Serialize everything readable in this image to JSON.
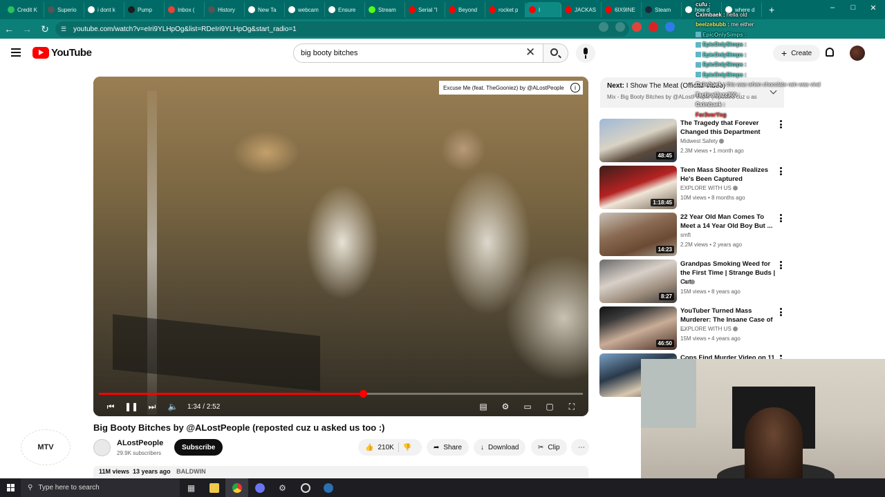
{
  "browser": {
    "tabs": [
      {
        "label": "Credit K",
        "icon": "credit-karma-icon",
        "color": "#2ac05e"
      },
      {
        "label": "Superio",
        "icon": "globe-icon",
        "color": "#555555"
      },
      {
        "label": "i dont k",
        "icon": "google-icon",
        "color": "#ffffff"
      },
      {
        "label": "Pump",
        "icon": "pump-icon",
        "color": "#1c1c1c"
      },
      {
        "label": "Inbox (",
        "icon": "gmail-icon",
        "color": "#ea4335"
      },
      {
        "label": "History",
        "icon": "history-icon",
        "color": "#555555"
      },
      {
        "label": "New Ta",
        "icon": "chrome-icon",
        "color": "#ffffff"
      },
      {
        "label": "webcam",
        "icon": "google-icon",
        "color": "#ffffff"
      },
      {
        "label": "Ensure",
        "icon": "google-icon",
        "color": "#ffffff"
      },
      {
        "label": "Stream",
        "icon": "kick-icon",
        "color": "#53fc18"
      },
      {
        "label": "Serial \"I",
        "icon": "youtube-icon",
        "color": "#ff0000"
      },
      {
        "label": "Beyond",
        "icon": "youtube-icon",
        "color": "#ff0000"
      },
      {
        "label": "rocket p",
        "icon": "youtube-icon",
        "color": "#ff0000"
      },
      {
        "label": "I",
        "icon": "youtube-icon",
        "color": "#ff0000",
        "active": true
      },
      {
        "label": "JACKAS",
        "icon": "youtube-icon",
        "color": "#ff0000"
      },
      {
        "label": "6IX9INE",
        "icon": "youtube-icon",
        "color": "#ff0000"
      },
      {
        "label": "Steam",
        "icon": "steam-icon",
        "color": "#1b2838"
      },
      {
        "label": "how d",
        "icon": "google-icon",
        "color": "#ffffff"
      },
      {
        "label": "where d",
        "icon": "google-icon",
        "color": "#ffffff"
      }
    ],
    "url": "youtube.com/watch?v=eIri9YLHpOg&list=RDeIri9YLHpOg&start_radio=1"
  },
  "yt": {
    "logo_text": "YouTube",
    "search_value": "big booty bitches",
    "create_label": "Create"
  },
  "player": {
    "next_card": "Excuse Me (feat. TheGooniez) by @ALostPeople",
    "time": "1:34 / 2:52",
    "progress_fraction": 0.546
  },
  "video": {
    "title": "Big Booty Bitches by @ALostPeople (reposted cuz u asked us too :)",
    "channel": "ALostPeople",
    "subscribers": "29.9K subscribers",
    "subscribe_label": "Subscribe",
    "likes": "210K",
    "share_label": "Share",
    "download_label": "Download",
    "clip_label": "Clip",
    "views": "11M views",
    "age": "13 years ago",
    "tag": "BALDWIN",
    "watermark": "MTV"
  },
  "mix": {
    "next_prefix": "Next:",
    "next_title": "I Show The Meat (Official Video)",
    "subtitle": "Mix - Big Booty Bitches by @ALostPeople (reposted cuz u as"
  },
  "recommendations": [
    {
      "title": "The Tragedy that Forever Changed this Department",
      "channel": "Midwest Safety",
      "verified": true,
      "meta": "2.3M views • 1 month ago",
      "duration": "48:45"
    },
    {
      "title": "Teen Mass Shooter Realizes He's Been Captured",
      "channel": "EXPLORE WITH US",
      "verified": true,
      "meta": "10M views • 8 months ago",
      "duration": "1:18:45"
    },
    {
      "title": "22 Year Old Man Comes To Meet a 14 Year Old Boy But ...",
      "channel": "smft",
      "verified": false,
      "meta": "2.2M views • 2 years ago",
      "duration": "14:23"
    },
    {
      "title": "Grandpas Smoking Weed for the First Time | Strange Buds | Cut",
      "channel": "Cut",
      "verified": true,
      "meta": "15M views • 8 years ago",
      "duration": "8:27"
    },
    {
      "title": "YouTuber Turned Mass Murderer: The Insane Case of ...",
      "channel": "EXPLORE WITH US",
      "verified": true,
      "meta": "15M views • 4 years ago",
      "duration": "46:50"
    },
    {
      "title": "Cops Find Murder Video on 11 ...",
      "channel": "",
      "verified": false,
      "meta": "",
      "duration": ""
    }
  ],
  "chat": [
    {
      "name": "cufu :",
      "text": "",
      "color": "white"
    },
    {
      "name": "Cximbaek :",
      "text": "hella old",
      "color": "white"
    },
    {
      "name": "beelzebubb :",
      "text": "me either",
      "color": "lime"
    },
    {
      "name": "EpicOnlySimps :",
      "text": "",
      "color": "teal"
    },
    {
      "name": "EpicOnlySimps :",
      "text": "",
      "color": "teal"
    },
    {
      "name": "EpicOnlySimps :",
      "text": "",
      "color": "teal"
    },
    {
      "name": "EpicOnlySimps :",
      "text": "",
      "color": "teal"
    },
    {
      "name": "EpicOnlySimps :",
      "text": "",
      "color": "teal"
    },
    {
      "name": "Cximbaek :",
      "text": "this was when chocolate rain was viral",
      "color": "white"
    },
    {
      "name": "TacticalJazz300 :",
      "text": "",
      "color": "white"
    },
    {
      "name": "Cximbaek :",
      "text": "",
      "color": "white"
    },
    {
      "name": "For3verYng",
      "text": "",
      "color": "red"
    }
  ],
  "taskbar": {
    "search_placeholder": "Type here to search"
  }
}
